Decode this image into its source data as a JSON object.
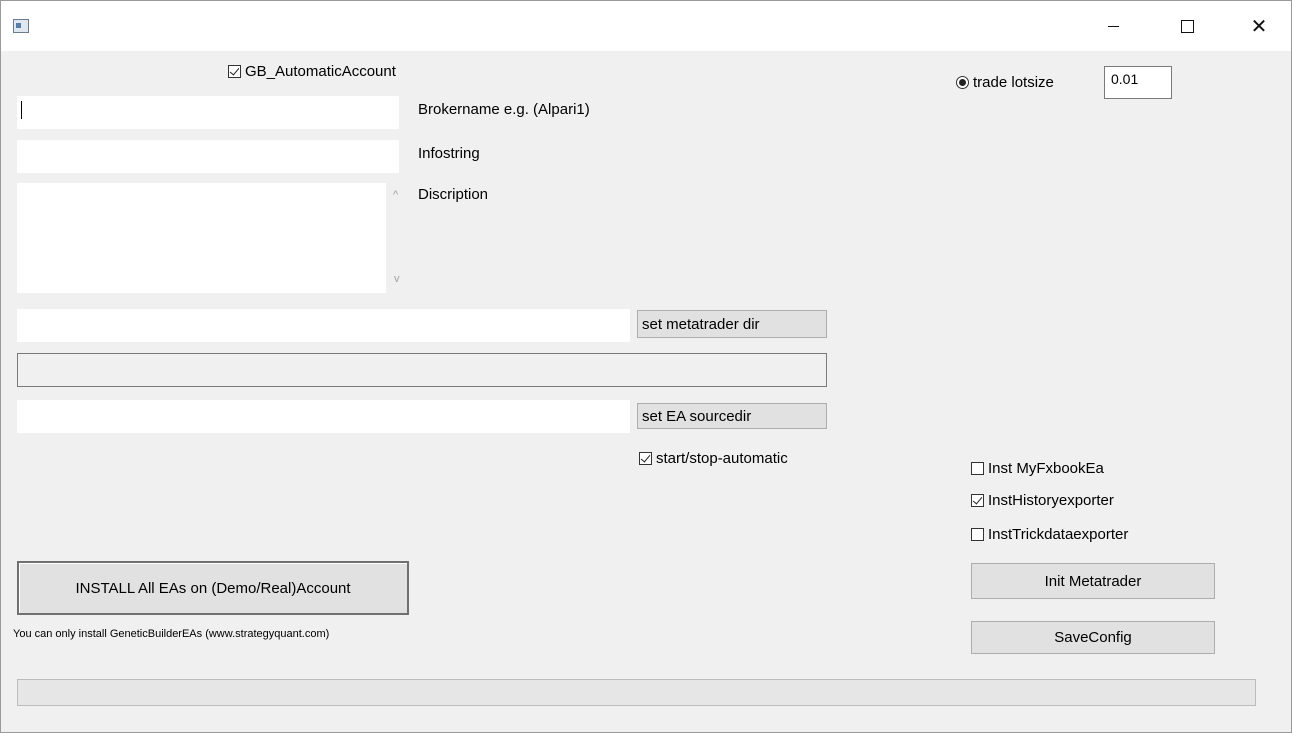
{
  "window": {
    "title": "",
    "minimize_glyph": "",
    "close_glyph": "✕"
  },
  "form": {
    "automatic_account_label": "GB_AutomaticAccount",
    "automatic_account_checked": true,
    "brokername_value": "",
    "brokername_label": "Brokername e.g. (Alpari1)",
    "infostring_value": "",
    "infostring_label": "Infostring",
    "description_value": "",
    "description_label": "Discription",
    "metatrader_dir_value": "",
    "set_metatrader_dir_label": "set metatrader dir",
    "path_display_value": "",
    "ea_sourcedir_value": "",
    "set_ea_sourcedir_label": "set EA sourcedir",
    "start_stop_label": "start/stop-automatic",
    "start_stop_checked": true,
    "install_button_label": "INSTALL All EAs on (Demo/Real)Account",
    "install_note": "You can only install GeneticBuilderEAs (www.strategyquant.com)"
  },
  "right_panel": {
    "trade_lotsize_label": "trade lotsize",
    "trade_lotsize_value": "0.01",
    "options": [
      {
        "label": "Inst MyFxbookEa",
        "checked": false
      },
      {
        "label": "InstHistoryexporter",
        "checked": true
      },
      {
        "label": "InstTrickdataexporter",
        "checked": false
      }
    ],
    "init_button_label": "Init Metatrader",
    "save_button_label": "SaveConfig"
  },
  "scroll": {
    "up_arrow": "^",
    "down_arrow": "v"
  },
  "progress_value": 0
}
